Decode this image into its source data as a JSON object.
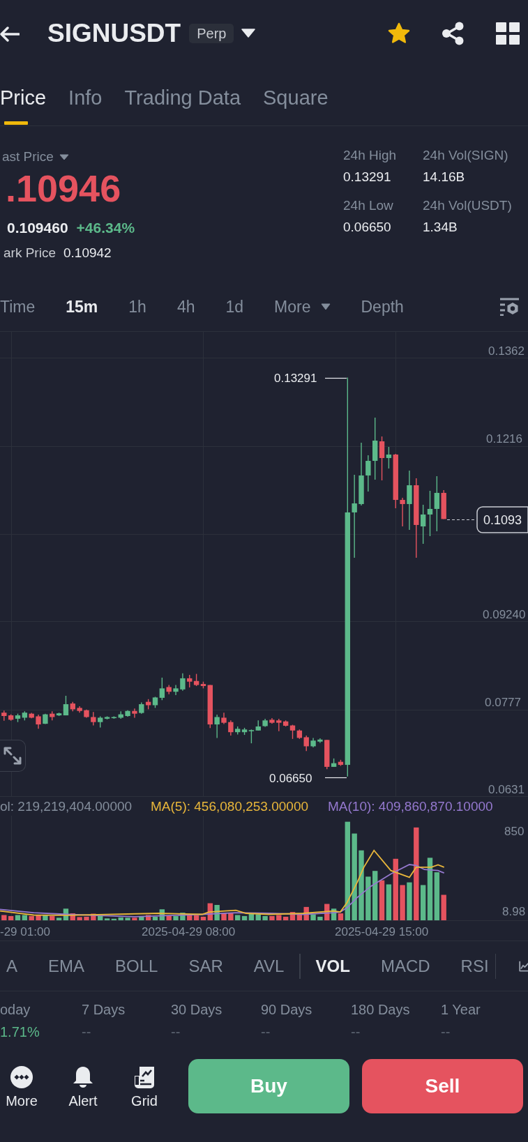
{
  "header": {
    "title": "SIGNUSDT",
    "badge": "Perp",
    "favorite": true
  },
  "tabs": [
    {
      "label": "Price",
      "selected": true
    },
    {
      "label": "Info",
      "selected": false
    },
    {
      "label": "Trading Data",
      "selected": false
    },
    {
      "label": "Square",
      "selected": false
    }
  ],
  "price": {
    "label": "ast Price",
    "last": ".10946",
    "last_falling": true,
    "usd": "0.109460",
    "change": "+46.34%",
    "change_rising": true,
    "mark_label": "ark Price",
    "mark": "0.10942",
    "stats": [
      {
        "label": "24h High",
        "value": "0.13291"
      },
      {
        "label": "24h Vol(SIGN)",
        "value": "14.16B"
      },
      {
        "label": "24h Low",
        "value": "0.06650"
      },
      {
        "label": "24h Vol(USDT)",
        "value": "1.34B"
      }
    ]
  },
  "intervals": [
    {
      "label": "Time",
      "kind": "option",
      "selected": false
    },
    {
      "label": "15m",
      "kind": "option",
      "selected": true
    },
    {
      "label": "1h",
      "kind": "option",
      "selected": false
    },
    {
      "label": "4h",
      "kind": "option",
      "selected": false
    },
    {
      "label": "1d",
      "kind": "option",
      "selected": false
    },
    {
      "label": "More",
      "kind": "menu",
      "selected": false
    },
    {
      "label": "Depth",
      "kind": "option",
      "selected": false
    }
  ],
  "chart": {
    "high_label": "0.13291",
    "low_label": "0.06650",
    "current_price": "0.1093",
    "chart_data": {
      "type": "candlestick",
      "ohlc": [
        [
          0.07712,
          0.07746,
          0.07578,
          0.07656
        ],
        [
          0.07667,
          0.07684,
          0.07578,
          0.07594
        ],
        [
          0.07611,
          0.07695,
          0.07555,
          0.07667
        ],
        [
          0.07628,
          0.07735,
          0.07583,
          0.07712
        ],
        [
          0.07695,
          0.07707,
          0.07617,
          0.07628
        ],
        [
          0.07651,
          0.07679,
          0.07443,
          0.07516
        ],
        [
          0.07527,
          0.07695,
          0.07522,
          0.07684
        ],
        [
          0.07695,
          0.07735,
          0.07583,
          0.07639
        ],
        [
          0.07667,
          0.07712,
          0.07656,
          0.07701
        ],
        [
          0.07667,
          0.07993,
          0.07667,
          0.07853
        ],
        [
          0.07864,
          0.07892,
          0.07735,
          0.07768
        ],
        [
          0.07791,
          0.07819,
          0.07712,
          0.0774
        ],
        [
          0.07752,
          0.07763,
          0.07628,
          0.07639
        ],
        [
          0.07639,
          0.07723,
          0.07499,
          0.07555
        ],
        [
          0.07555,
          0.07651,
          0.07466,
          0.07628
        ],
        [
          0.07611,
          0.07651,
          0.076,
          0.07639
        ],
        [
          0.07622,
          0.07651,
          0.07611,
          0.07639
        ],
        [
          0.07628,
          0.07735,
          0.07611,
          0.07684
        ],
        [
          0.07656,
          0.07752,
          0.07645,
          0.0774
        ],
        [
          0.0774,
          0.0778,
          0.07628,
          0.07695
        ],
        [
          0.07707,
          0.07881,
          0.07695,
          0.07853
        ],
        [
          0.07892,
          0.07937,
          0.07768,
          0.07836
        ],
        [
          0.07836,
          0.07976,
          0.07791,
          0.07965
        ],
        [
          0.07959,
          0.08295,
          0.0792,
          0.08116
        ],
        [
          0.08138,
          0.08172,
          0.0802,
          0.0806
        ],
        [
          0.0806,
          0.08172,
          0.08004,
          0.08116
        ],
        [
          0.08099,
          0.08368,
          0.08077,
          0.08284
        ],
        [
          0.08284,
          0.0834,
          0.08133,
          0.08228
        ],
        [
          0.08239,
          0.08357,
          0.08155,
          0.08172
        ],
        [
          0.08189,
          0.08228,
          0.08116,
          0.08155
        ],
        [
          0.08172,
          0.08172,
          0.07455,
          0.07516
        ],
        [
          0.07516,
          0.07679,
          0.07292,
          0.07639
        ],
        [
          0.07628,
          0.07712,
          0.07522,
          0.07544
        ],
        [
          0.07555,
          0.07583,
          0.07331,
          0.07387
        ],
        [
          0.07387,
          0.07482,
          0.07348,
          0.07443
        ],
        [
          0.07387,
          0.0746,
          0.07342,
          0.07432
        ],
        [
          0.07404,
          0.07432,
          0.07202,
          0.07421
        ],
        [
          0.07415,
          0.07583,
          0.07415,
          0.07482
        ],
        [
          0.07488,
          0.07611,
          0.07477,
          0.07583
        ],
        [
          0.07594,
          0.07622,
          0.07527,
          0.07544
        ],
        [
          0.07583,
          0.07611,
          0.07404,
          0.07544
        ],
        [
          0.07566,
          0.07583,
          0.07482,
          0.07494
        ],
        [
          0.07499,
          0.0751,
          0.07275,
          0.07415
        ],
        [
          0.07415,
          0.07432,
          0.07275,
          0.07292
        ],
        [
          0.07303,
          0.07331,
          0.07073,
          0.07152
        ],
        [
          0.07152,
          0.07292,
          0.07135,
          0.07247
        ],
        [
          0.0723,
          0.07286,
          0.07208,
          0.07264
        ],
        [
          0.07258,
          0.07258,
          0.0677,
          0.0681
        ],
        [
          0.0681,
          0.0695,
          0.0681,
          0.06871
        ],
        [
          0.06894,
          0.06927,
          0.06826,
          0.06843
        ],
        [
          0.06843,
          0.13291,
          0.0665,
          0.11045
        ],
        [
          0.11045,
          0.11671,
          0.1029,
          0.11195
        ],
        [
          0.11184,
          0.12205,
          0.11161,
          0.1166
        ],
        [
          0.1166,
          0.11996,
          0.11393,
          0.11903
        ],
        [
          0.11903,
          0.12623,
          0.1159,
          0.1224
        ],
        [
          0.12228,
          0.12309,
          0.11578,
          0.1195
        ],
        [
          0.1195,
          0.12135,
          0.11776,
          0.12008
        ],
        [
          0.12008,
          0.12019,
          0.11114,
          0.11253
        ],
        [
          0.11253,
          0.11288,
          0.10812,
          0.11184
        ],
        [
          0.11184,
          0.11741,
          0.10754,
          0.11497
        ],
        [
          0.11497,
          0.11613,
          0.1029,
          0.10836
        ],
        [
          0.10812,
          0.11172,
          0.10522,
          0.1101
        ],
        [
          0.1101,
          0.11404,
          0.1065,
          0.11103
        ],
        [
          0.11103,
          0.11648,
          0.10731,
          0.1137
        ],
        [
          0.1137,
          0.11416,
          0.10935,
          0.10935
        ]
      ],
      "ylim": [
        0.0631,
        0.1405
      ],
      "yticks": [
        {
          "value": 0.1362,
          "label": "0.1362"
        },
        {
          "value": 0.1216,
          "label": "0.1216"
        },
        {
          "value": 0.0924,
          "label": "0.09240"
        },
        {
          "value": 0.0777,
          "label": "0.0777"
        },
        {
          "value": 0.0631,
          "label": "0.0631"
        }
      ],
      "grid": true
    }
  },
  "volume": {
    "legend": [
      {
        "text": "ol: 219,219,404.00000",
        "color": "#848e9c"
      },
      {
        "text": "MA(5): 456,080,253.00000",
        "color": "#e9b73b"
      },
      {
        "text": "MA(10): 409,860,870.10000",
        "color": "#9579cf"
      }
    ],
    "axis": [
      "850",
      "8.98"
    ],
    "dates": [
      "-29 01:00",
      "2025-04-29 08:00",
      "2025-04-29 15:00"
    ]
  },
  "indicators": {
    "main": [
      {
        "label": "A",
        "selected": false
      },
      {
        "label": "EMA",
        "selected": false
      },
      {
        "label": "BOLL",
        "selected": false
      },
      {
        "label": "SAR",
        "selected": false
      },
      {
        "label": "AVL",
        "selected": false
      }
    ],
    "sub": [
      {
        "label": "VOL",
        "selected": true
      },
      {
        "label": "MACD",
        "selected": false
      },
      {
        "label": "RSI",
        "selected": false
      }
    ]
  },
  "performance": [
    {
      "label": "oday",
      "value": "1.71%",
      "rising": true
    },
    {
      "label": "7 Days",
      "value": "--",
      "rising": false
    },
    {
      "label": "30 Days",
      "value": "--",
      "rising": false
    },
    {
      "label": "90 Days",
      "value": "--",
      "rising": false
    },
    {
      "label": "180 Days",
      "value": "--",
      "rising": false
    },
    {
      "label": "1 Year",
      "value": "--",
      "rising": false
    }
  ],
  "actions": [
    {
      "label": "More",
      "kind": "more"
    },
    {
      "label": "Alert",
      "kind": "alert"
    },
    {
      "label": "Grid",
      "kind": "grid"
    }
  ],
  "trade": [
    {
      "label": "Buy",
      "kind": "buy"
    },
    {
      "label": "Sell",
      "kind": "sell"
    }
  ]
}
